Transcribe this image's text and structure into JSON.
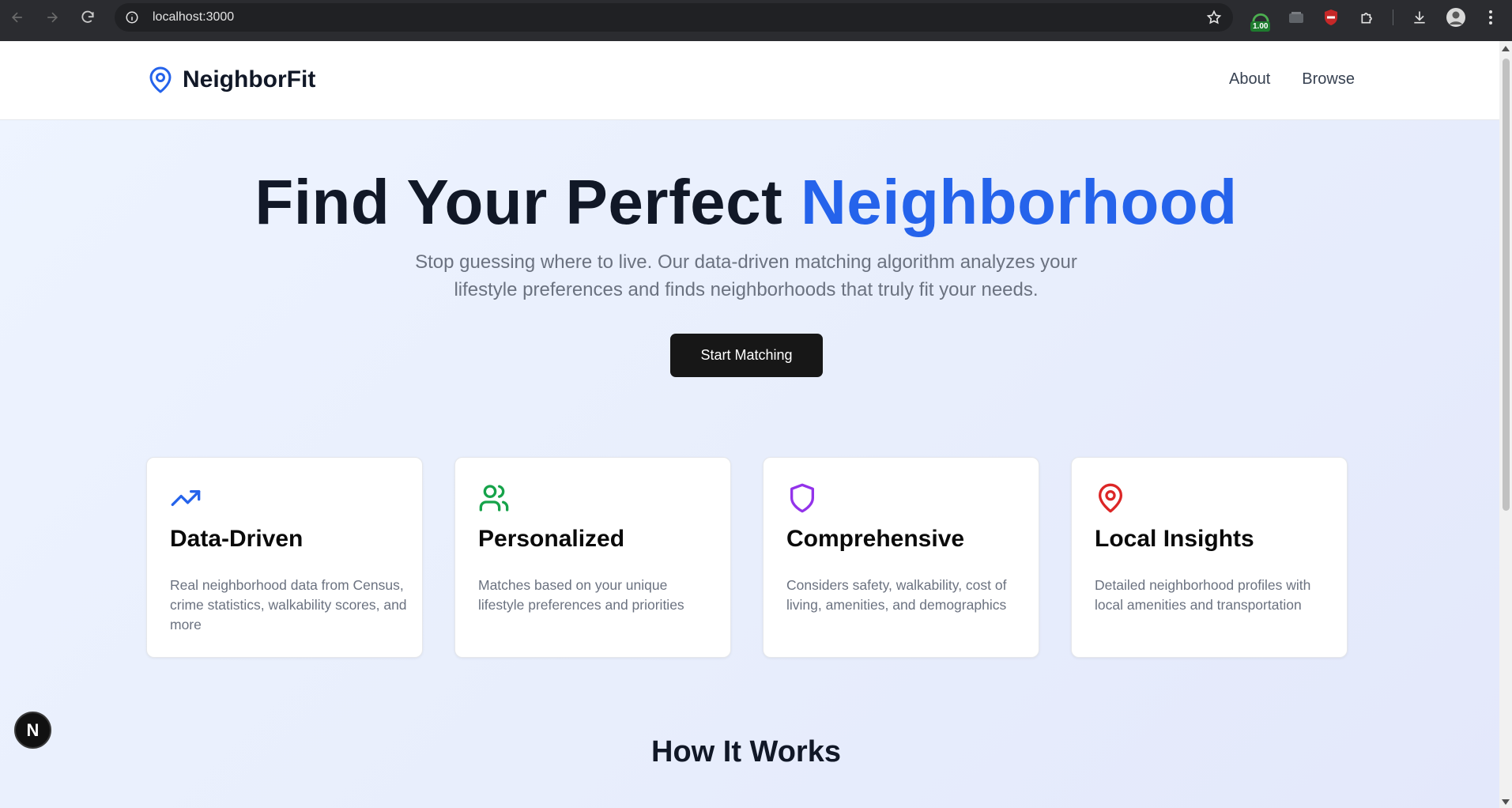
{
  "browser": {
    "url": "localhost:3000",
    "extension_badge": "1.00"
  },
  "header": {
    "brand": "NeighborFit",
    "nav": [
      "About",
      "Browse"
    ]
  },
  "hero": {
    "title_main": "Find Your Perfect ",
    "title_accent": "Neighborhood",
    "subtitle": "Stop guessing where to live. Our data-driven matching algorithm analyzes your lifestyle preferences and finds neighborhoods that truly fit your needs.",
    "cta": "Start Matching"
  },
  "features": [
    {
      "icon": "trending-up-icon",
      "color": "#2563eb",
      "title": "Data-Driven",
      "desc": "Real neighborhood data from Census, crime statistics, walkability scores, and more"
    },
    {
      "icon": "users-icon",
      "color": "#16a34a",
      "title": "Personalized",
      "desc": "Matches based on your unique lifestyle preferences and priorities"
    },
    {
      "icon": "shield-icon",
      "color": "#9333ea",
      "title": "Comprehensive",
      "desc": "Considers safety, walkability, cost of living, amenities, and demographics"
    },
    {
      "icon": "map-pin-icon",
      "color": "#dc2626",
      "title": "Local Insights",
      "desc": "Detailed neighborhood profiles with local amenities and transportation"
    }
  ],
  "how_it_works": {
    "title": "How It Works"
  },
  "dev_badge": "N"
}
